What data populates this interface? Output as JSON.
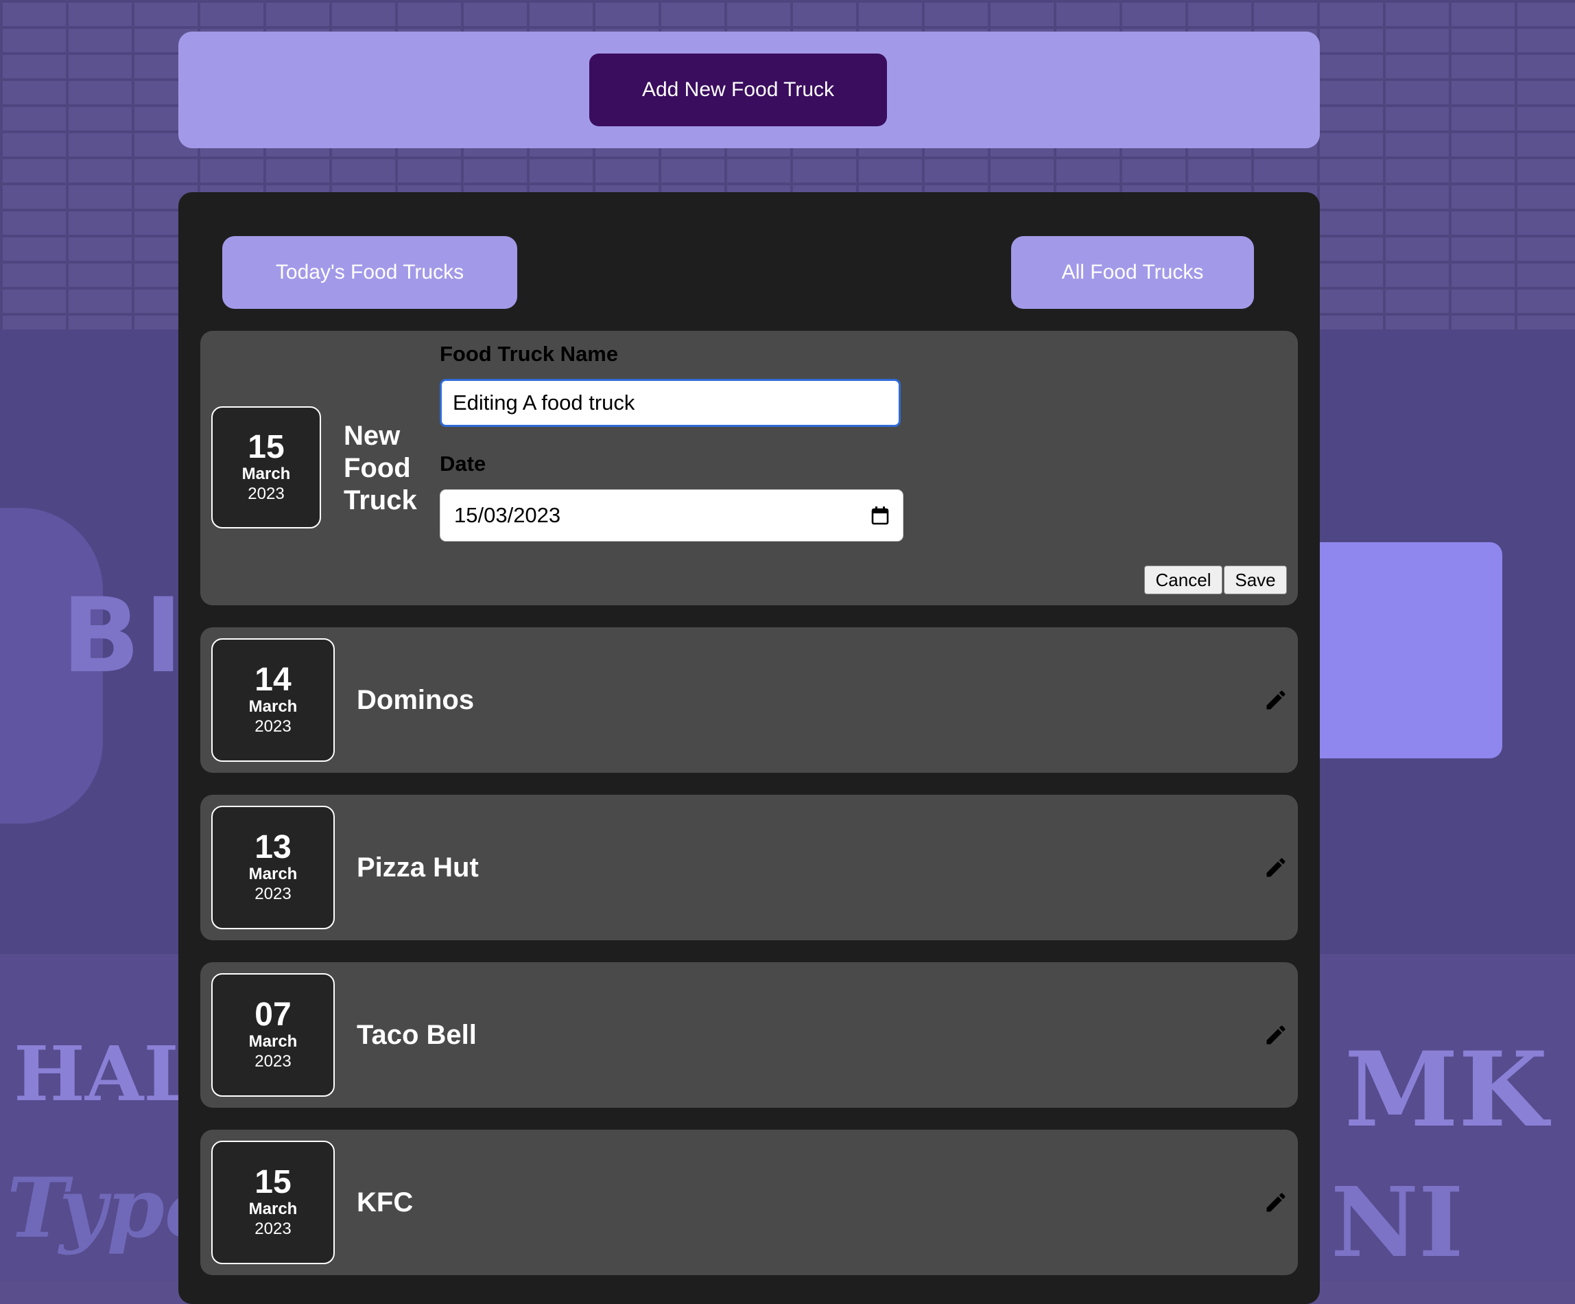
{
  "colors": {
    "accent": "#a29ae8",
    "primary_button": "#3a0d5e",
    "panel": "#1e1e1e",
    "card": "#4a4a4a",
    "focus": "#2f6bd8"
  },
  "header": {
    "add_button_label": "Add New Food Truck"
  },
  "filters": {
    "today_label": "Today's Food Trucks",
    "all_label": "All Food Trucks"
  },
  "edit_form": {
    "date": {
      "day": "15",
      "month": "March",
      "year": "2023"
    },
    "title": "New Food Truck",
    "name_label": "Food Truck Name",
    "name_value": "Editing A food truck",
    "date_label": "Date",
    "date_value": "15/03/2023",
    "date_icon": "calendar-icon",
    "cancel_label": "Cancel",
    "save_label": "Save"
  },
  "trucks": [
    {
      "day": "14",
      "month": "March",
      "year": "2023",
      "name": "Dominos",
      "icon": "pencil-icon"
    },
    {
      "day": "13",
      "month": "March",
      "year": "2023",
      "name": "Pizza Hut",
      "icon": "pencil-icon"
    },
    {
      "day": "07",
      "month": "March",
      "year": "2023",
      "name": "Taco Bell",
      "icon": "pencil-icon"
    },
    {
      "day": "15",
      "month": "March",
      "year": "2023",
      "name": "KFC",
      "icon": "pencil-icon"
    }
  ]
}
